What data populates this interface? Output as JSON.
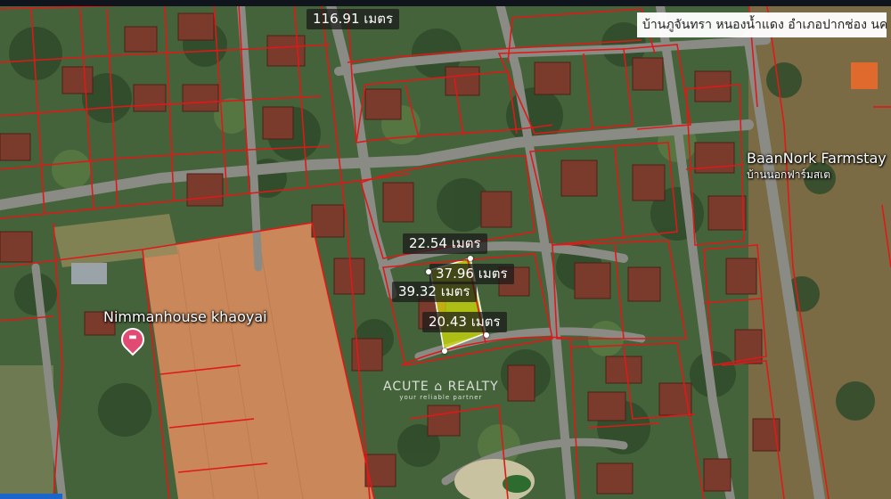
{
  "map": {
    "location_text": "บ้านภูจันทรา หนองน้ำแดง อำเภอปากช่อง นครร",
    "measurements": [
      {
        "id": "top",
        "text": "116.91 เมตร"
      },
      {
        "id": "north",
        "text": "22.54 เมตร"
      },
      {
        "id": "east",
        "text": "37.96 เมตร"
      },
      {
        "id": "west",
        "text": "39.32 เมตร"
      },
      {
        "id": "south",
        "text": "20.43 เมตร"
      }
    ],
    "places": {
      "farmstay_name": "BaanNork Farmstay",
      "farmstay_thai": "บ้านนอกฟาร์มสเต",
      "hotel_name": "Nimmanhouse khaoyai"
    },
    "watermark": {
      "brand_left": "ACUTE",
      "brand_right": "REALTY",
      "tagline": "your reliable partner"
    },
    "colors": {
      "parcel_line": "#e01818",
      "highlight": "#e5f000",
      "road": "#8b8b86",
      "field": "#c9875a",
      "pin": "#e14b73"
    },
    "icons": {
      "hotel_pin": "bed-pin-icon"
    }
  }
}
